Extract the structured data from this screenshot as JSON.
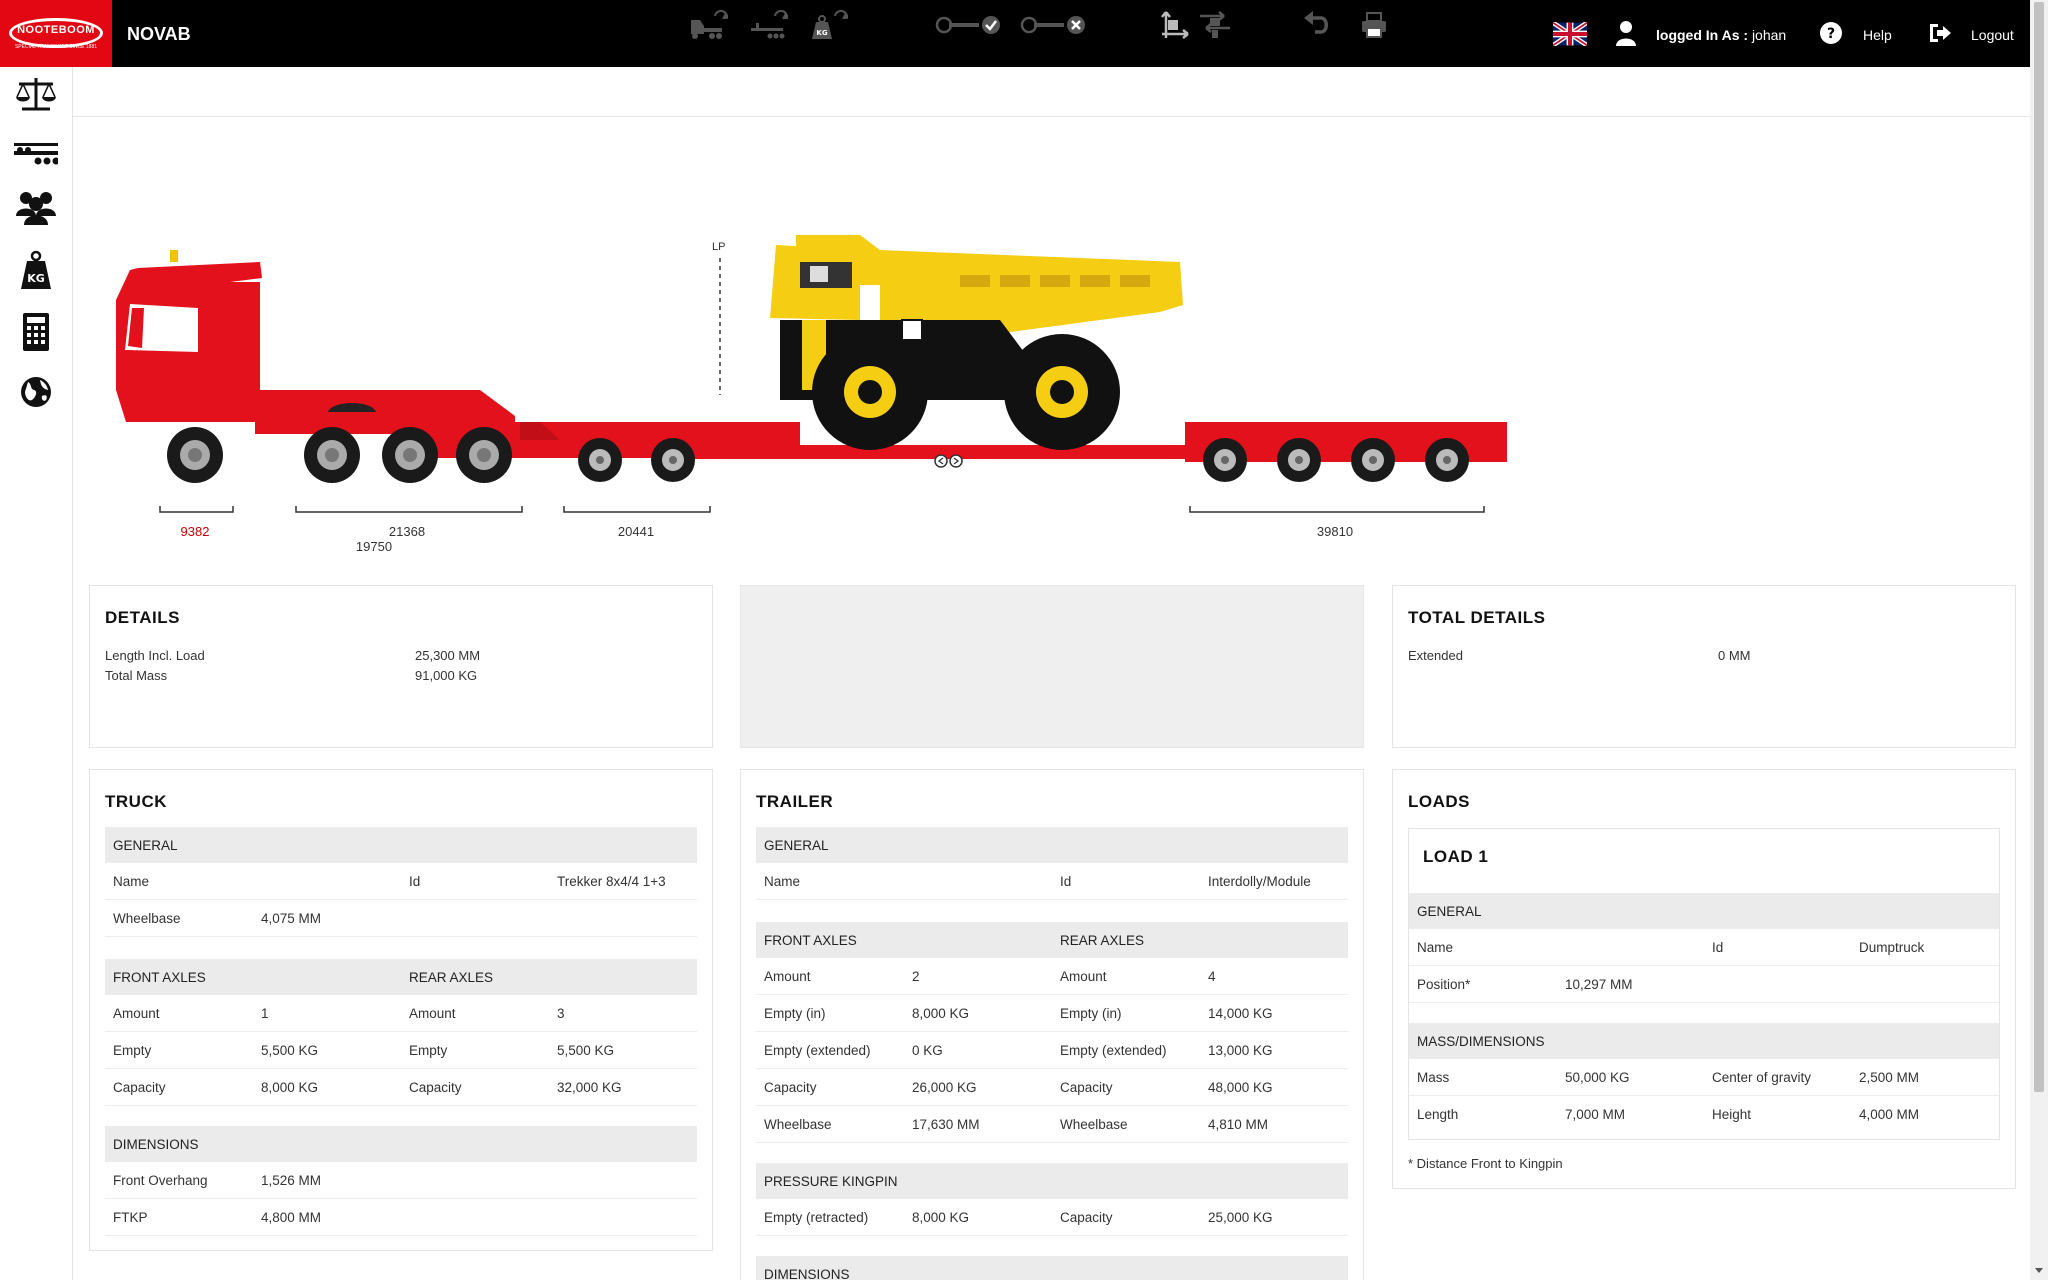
{
  "header": {
    "logo_text": "NOOTEBOOM",
    "logo_sub": "SPECIAL TRANSPORT SINCE 1881",
    "app_name": "NOVAB",
    "user_prefix": "logged In As :",
    "user_name": "johan",
    "help_label": "Help",
    "logout_label": "Logout"
  },
  "sidebar": {
    "items": [
      "scales-icon",
      "trailer-icon",
      "group-icon",
      "weight-kg-icon",
      "calculator-icon",
      "globe-icon"
    ]
  },
  "toolbar": {
    "items": [
      "swap-truck-icon",
      "swap-trailer-icon",
      "swap-load-icon",
      "connect-check-icon",
      "connect-cancel-icon",
      "move-disabled-icon",
      "move-icon",
      "undo-icon",
      "print-icon"
    ]
  },
  "drawing": {
    "lp_label": "LP",
    "dims": {
      "front": "9382",
      "truck_rear": "21368",
      "truck_rear_2": "19750",
      "dolly": "20441",
      "module": "39810"
    }
  },
  "details": {
    "title": "DETAILS",
    "rows": [
      {
        "label": "Length Incl. Load",
        "value": "25,300 MM"
      },
      {
        "label": "Total Mass",
        "value": "91,000 KG"
      }
    ]
  },
  "total_details": {
    "title": "TOTAL DETAILS",
    "rows": [
      {
        "label": "Extended",
        "value": "0 MM"
      }
    ]
  },
  "truck": {
    "title": "TRUCK",
    "general_head": "GENERAL",
    "name_label": "Name",
    "id_label": "Id",
    "id_value": "Trekker 8x4/4 1+3",
    "wheelbase_label": "Wheelbase",
    "wheelbase_value": "4,075 MM",
    "front_axles_head": "FRONT AXLES",
    "rear_axles_head": "REAR AXLES",
    "axle_rows": [
      {
        "label": "Amount",
        "front": "1",
        "rear_label": "Amount",
        "rear": "3"
      },
      {
        "label": "Empty",
        "front": "5,500 KG",
        "rear_label": "Empty",
        "rear": "5,500 KG"
      },
      {
        "label": "Capacity",
        "front": "8,000 KG",
        "rear_label": "Capacity",
        "rear": "32,000 KG"
      }
    ],
    "dimensions_head": "DIMENSIONS",
    "dim_rows": [
      {
        "label": "Front Overhang",
        "value": "1,526 MM"
      },
      {
        "label": "FTKP",
        "value": "4,800 MM"
      }
    ]
  },
  "trailer": {
    "title": "TRAILER",
    "general_head": "GENERAL",
    "name_label": "Name",
    "id_label": "Id",
    "id_value": "Interdolly/Module",
    "front_axles_head": "FRONT AXLES",
    "rear_axles_head": "REAR AXLES",
    "axle_rows": [
      {
        "label": "Amount",
        "front": "2",
        "rear_label": "Amount",
        "rear": "4"
      },
      {
        "label": "Empty (in)",
        "front": "8,000 KG",
        "rear_label": "Empty (in)",
        "rear": "14,000 KG"
      },
      {
        "label": "Empty (extended)",
        "front": "0 KG",
        "rear_label": "Empty (extended)",
        "rear": "13,000 KG"
      },
      {
        "label": "Capacity",
        "front": "26,000 KG",
        "rear_label": "Capacity",
        "rear": "48,000 KG"
      },
      {
        "label": "Wheelbase",
        "front": "17,630 MM",
        "rear_label": "Wheelbase",
        "rear": "4,810 MM"
      }
    ],
    "kingpin_head": "PRESSURE KINGPIN",
    "kingpin_row": {
      "label": "Empty (retracted)",
      "value": "8,000 KG",
      "cap_label": "Capacity",
      "cap_value": "25,000 KG"
    },
    "dimensions_head": "DIMENSIONS"
  },
  "loads": {
    "title": "LOADS",
    "load_title": "LOAD 1",
    "general_head": "GENERAL",
    "name_label": "Name",
    "id_label": "Id",
    "id_value": "Dumptruck",
    "position_label": "Position*",
    "position_value": "10,297 MM",
    "mass_head": "MASS/DIMENSIONS",
    "mass_rows": [
      {
        "label": "Mass",
        "value": "50,000 KG",
        "label2": "Center of gravity",
        "value2": "2,500 MM"
      },
      {
        "label": "Length",
        "value": "7,000 MM",
        "label2": "Height",
        "value2": "4,000 MM"
      }
    ],
    "footnote": "* Distance Front to Kingpin"
  }
}
